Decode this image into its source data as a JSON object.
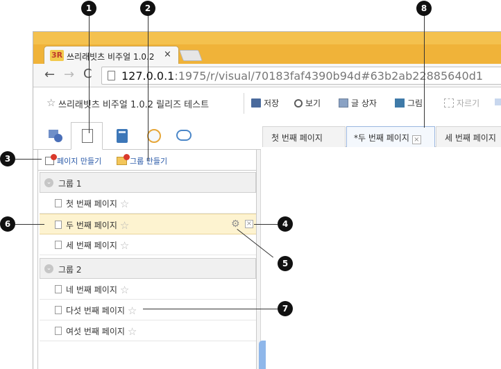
{
  "browser": {
    "tab_logo": "3R",
    "tab_title": "쓰리래빗츠 비주얼 1.0.2",
    "tab_close": "×",
    "url_host": "127.0.0.1",
    "url_rest": ":1975/r/visual/70183faf4390b94d#63b2ab22885640d1"
  },
  "nav": {
    "back": "←",
    "forward": "→",
    "reload": "C"
  },
  "app": {
    "star": "☆",
    "title": "쓰리래빗츠 비주얼 1.0.2 릴리즈 테스트",
    "tools": {
      "save": "저장",
      "view": "보기",
      "textbox": "글 상자",
      "image": "그림",
      "crop": "자르기"
    }
  },
  "view_tabs": [
    "shapes-icon",
    "pages-icon",
    "book-icon",
    "clock-icon",
    "comment-icon"
  ],
  "panel": {
    "add_page": "페이지 만들기",
    "add_group": "그룹 만들기",
    "groups": [
      {
        "name": "그룹 1",
        "pages": [
          "첫 번째 페이지",
          "두 번째 페이지",
          "세 번째 페이지"
        ]
      },
      {
        "name": "그룹 2",
        "pages": [
          "네 번째 페이지",
          "다섯 번째 페이지",
          "여섯 번째 페이지"
        ]
      }
    ],
    "star": "☆",
    "gear": "⚙",
    "remove": "×"
  },
  "page_tabs": [
    {
      "label": "첫 번째 페이지"
    },
    {
      "label": "*두 번째 페이지"
    },
    {
      "label": "세 번째 페이지"
    }
  ],
  "callouts": [
    "1",
    "2",
    "3",
    "4",
    "5",
    "6",
    "7",
    "8"
  ]
}
